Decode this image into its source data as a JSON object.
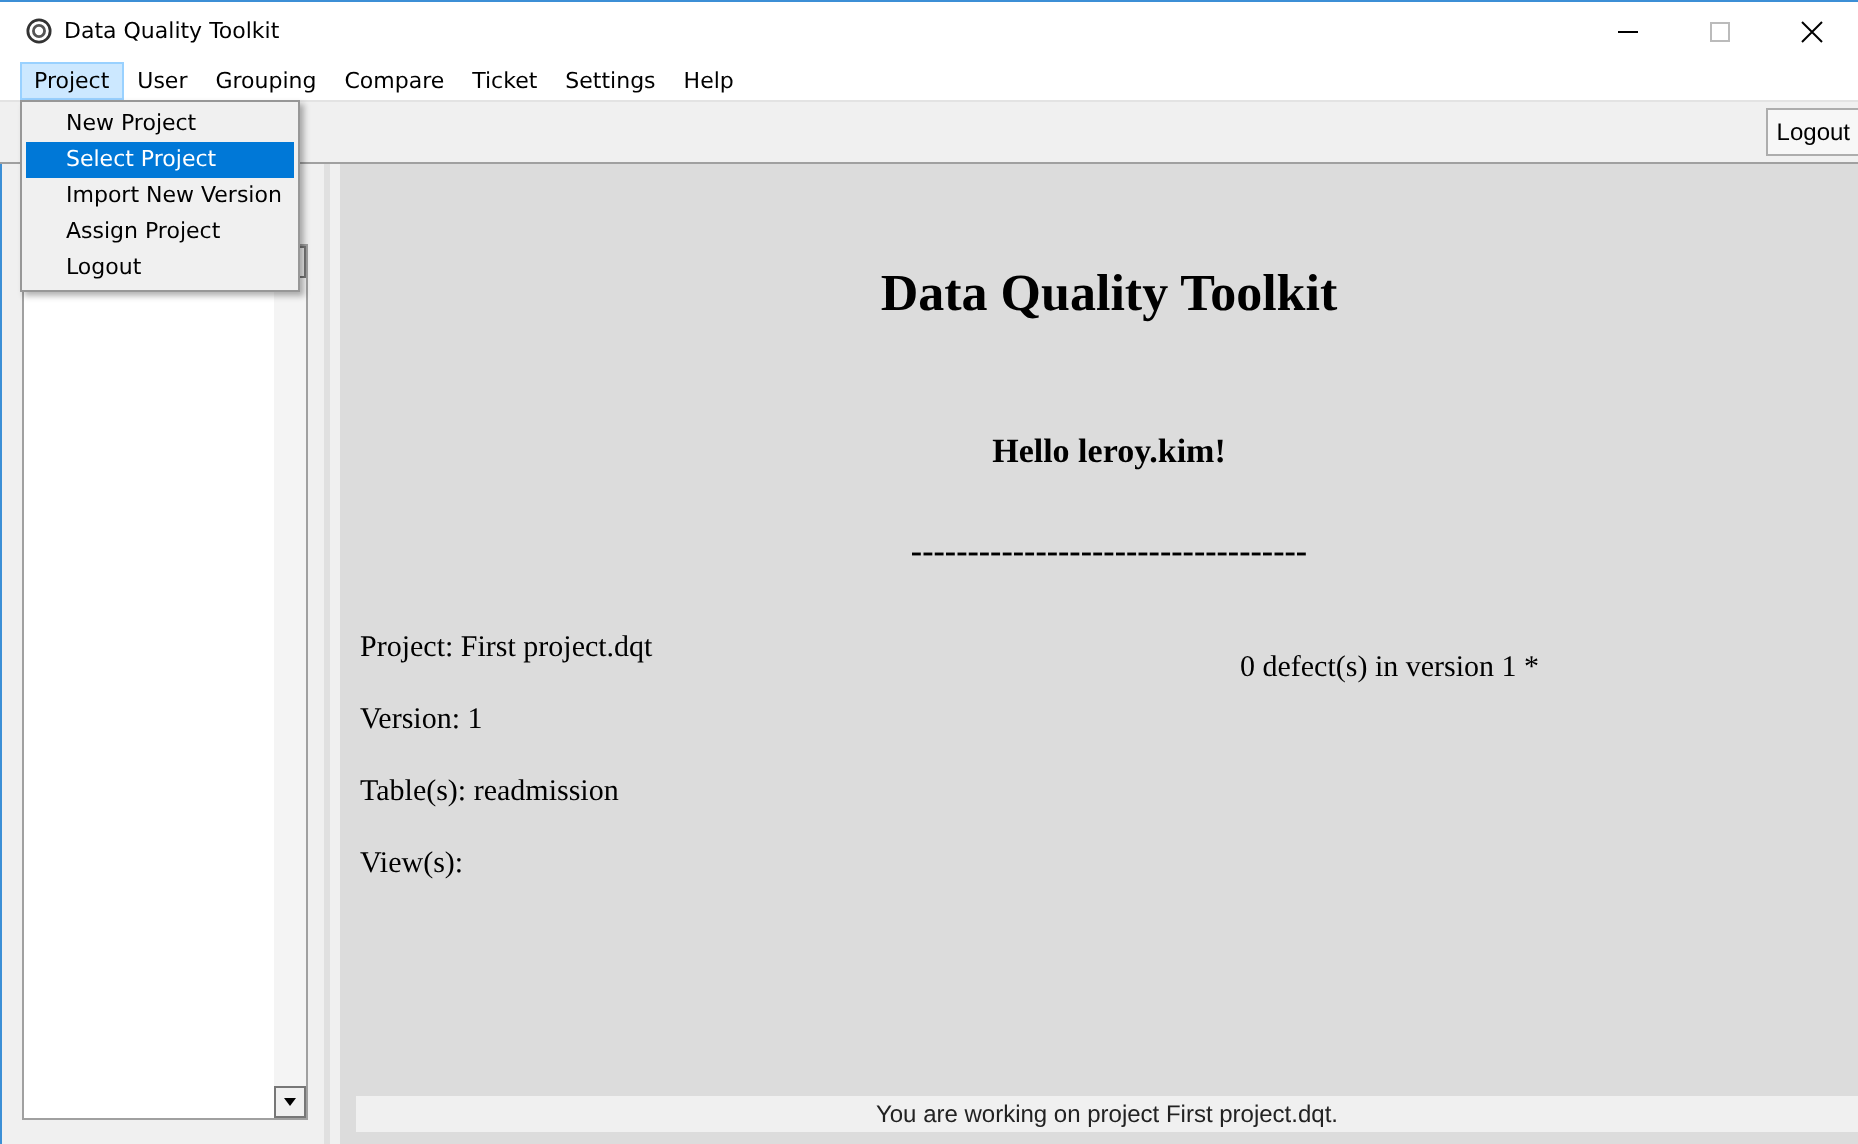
{
  "window": {
    "title": "Data Quality Toolkit"
  },
  "menu": [
    {
      "label": "Project",
      "selected": true
    },
    {
      "label": "User",
      "selected": false
    },
    {
      "label": "Grouping",
      "selected": false
    },
    {
      "label": "Compare",
      "selected": false
    },
    {
      "label": "Ticket",
      "selected": false
    },
    {
      "label": "Settings",
      "selected": false
    },
    {
      "label": "Help",
      "selected": false
    }
  ],
  "dropdown": [
    {
      "label": "New Project",
      "selected": false
    },
    {
      "label": "Select Project",
      "selected": true
    },
    {
      "label": "Import New Version",
      "selected": false
    },
    {
      "label": "Assign Project",
      "selected": false
    },
    {
      "label": "Logout",
      "selected": false
    }
  ],
  "toolbar": {
    "logout_button": "Logout"
  },
  "main": {
    "title": "Data Quality Toolkit",
    "greeting": "Hello leroy.kim!",
    "separator": "-----------------------------------",
    "details": [
      "Project: First project.dqt",
      "Version: 1",
      "Table(s): readmission",
      "View(s):"
    ],
    "defects": "0 defect(s) in version 1 *"
  },
  "status_bar": "You are working on project First project.dqt."
}
